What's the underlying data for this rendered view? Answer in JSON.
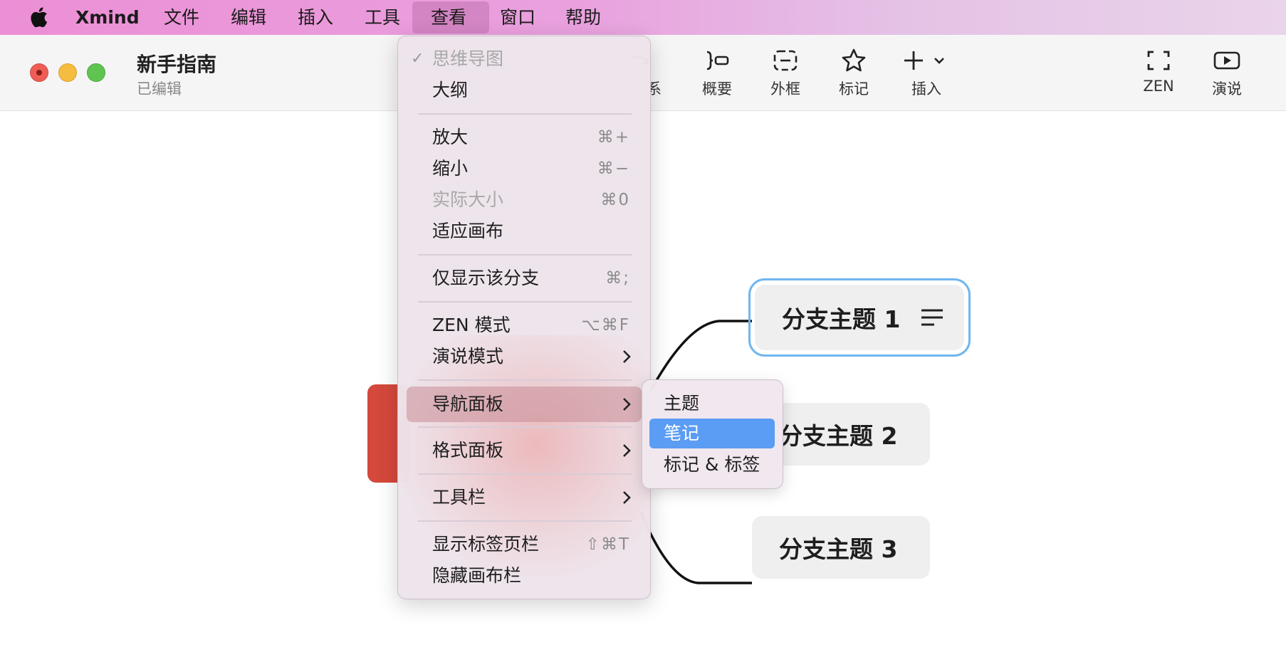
{
  "menubar": {
    "app_name": "Xmind",
    "items": [
      "文件",
      "编辑",
      "插入",
      "工具",
      "查看",
      "窗口",
      "帮助"
    ],
    "active_item": "查看"
  },
  "window": {
    "title": "新手指南",
    "subtitle": "已编辑"
  },
  "toolbar": {
    "relation_partial": "系",
    "summary": "概要",
    "boundary": "外框",
    "marker": "标记",
    "insert": "插入",
    "zen": "ZEN",
    "present": "演说"
  },
  "view_menu": {
    "mindmap": "思维导图",
    "outline": "大纲",
    "zoom_in": "放大",
    "zoom_in_sc": "⌘+",
    "zoom_out": "缩小",
    "zoom_out_sc": "⌘−",
    "actual_size": "实际大小",
    "actual_size_sc": "⌘0",
    "fit_canvas": "适应画布",
    "show_branch_only": "仅显示该分支",
    "show_branch_only_sc": "⌘;",
    "zen_mode": "ZEN 模式",
    "zen_mode_sc": "⌥⌘F",
    "pitch_mode": "演说模式",
    "nav_panel": "导航面板",
    "format_panel": "格式面板",
    "toolbar": "工具栏",
    "show_tab_bar": "显示标签页栏",
    "show_tab_bar_sc": "⇧⌘T",
    "hide_canvas_bar": "隐藏画布栏"
  },
  "nav_submenu": {
    "topic": "主题",
    "notes": "笔记",
    "markers_labels": "标记 & 标签"
  },
  "mindmap": {
    "branch1": "分支主题 1",
    "branch2": "分支主题 2",
    "branch3": "分支主题 3"
  },
  "colors": {
    "central_topic": "#d5483c",
    "selection": "#6fb6f0",
    "submenu_active": "#5b9cf4"
  }
}
